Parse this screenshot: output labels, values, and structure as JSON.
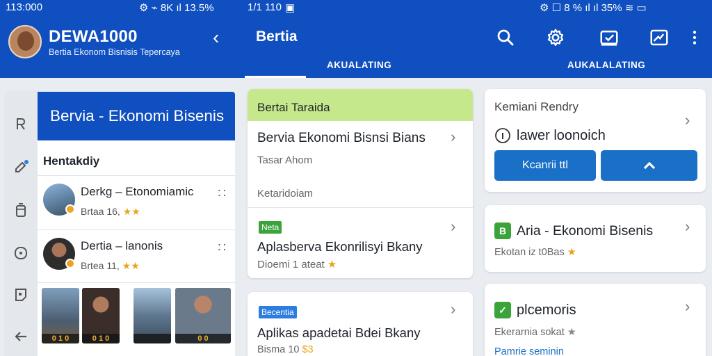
{
  "status_left": {
    "time": "113:000",
    "icons": "⚙ ⌁ 8K ıl 13.5%"
  },
  "status_mid": {
    "time": "1/1 110",
    "icon": "▣"
  },
  "status_right": {
    "icons": "⚙ ☐ 8 % ıl ıl 35% ≋ ▭"
  },
  "app": {
    "title": "DEWA1000",
    "tagline": "Bertia Ekonom Bisnisis Tepercaya"
  },
  "section": {
    "title": "Bertia"
  },
  "tabs": [
    {
      "label": "AKUALATING"
    },
    {
      "label": "AUKALALATING"
    }
  ],
  "icons": {
    "search": "search-icon",
    "settings": "gear-icon",
    "check": "checkbox-icon",
    "image": "image-icon",
    "more": "more-vert-icon"
  },
  "list": {
    "header": "Bervia - Ekonomi Bisenis",
    "subheader": "Hentakdiy",
    "items": [
      {
        "title": "Derkg – Etonomiamic",
        "meta": "Brtaa 16,",
        "stars": "★★"
      },
      {
        "title": "Dertia – lanonis",
        "meta": "Brtea 11,",
        "stars": "★★"
      }
    ],
    "thumbs": [
      {
        "label": "0 1 0"
      },
      {
        "label": "0 1 0"
      },
      {
        "label": ""
      },
      {
        "label": "0 0"
      }
    ]
  },
  "middle": {
    "card1": {
      "header": "Bertai Taraida",
      "row1_title": "Bervia Ekonomi Bisnsi Bians",
      "row1_sub": "Tasar Ahom",
      "row2_sub": "Ketaridoiam"
    },
    "card2": {
      "tag": "Neta",
      "title": "Aplasberva Ekonrilisyi Bkany",
      "meta": "Dioemi 1 ateat",
      "star": "★"
    },
    "card3": {
      "tag": "Becentia",
      "title": "Aplikas apadetai Bdei Bkany",
      "meta": "Bisma 10 ",
      "star": "$3"
    }
  },
  "right": {
    "card1": {
      "label": "Kemiani Rendry",
      "title": "lawer loonoich",
      "btn_primary": "Kcanrii ttl",
      "btn_secondary_icon": "chevron-up-icon"
    },
    "card2": {
      "icon_letter": "B",
      "title": "Aria - Ekonomi Bisenis",
      "meta": "Ekotan iz t0Bas",
      "star": "★"
    },
    "card3": {
      "icon_letter": "✓",
      "title": "plcemoris",
      "meta": "Ekerarnia sokat",
      "star": "★",
      "link": "Pamrie seminin"
    }
  },
  "colors": {
    "primary": "#0f4fbf",
    "accent_green": "#c6e88c",
    "tag_green": "#3aa43a",
    "tag_blue": "#2b7de0",
    "button_blue": "#1a70c6",
    "star": "#e5a41b"
  }
}
